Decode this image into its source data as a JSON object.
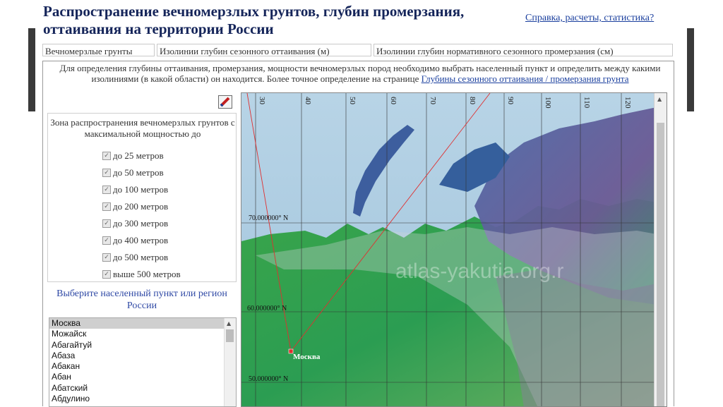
{
  "header": {
    "title_line1": "Распространение вечномерзлых грунтов, глубин промерзания,",
    "title_line2": "оттаивания на территории России",
    "help_link": "Справка, расчеты, статистика?"
  },
  "tabs": [
    {
      "label": "Вечномерзлые грунты"
    },
    {
      "label": "Изолинии глубин сезонного оттаивания (м)"
    },
    {
      "label": "Изолинии глубин нормативного сезонного промерзания (см)"
    }
  ],
  "instructions": {
    "text": "Для определения глубины оттаивания, промерзания, мощности вечномерзлых пород необходимо выбрать населенный пункт и определить между какими изолиниями (в какой области) он находится. Более точное определение на странице ",
    "link": "Глубины сезонного оттаивания / промерзания грунта"
  },
  "zone_panel": {
    "title": "Зона распространения вечномерзлых грунтов с максимальной мощностью до",
    "items": [
      {
        "label": "до 25  метров",
        "checked": true
      },
      {
        "label": "до 50  метров",
        "checked": true
      },
      {
        "label": "до 100 метров",
        "checked": true
      },
      {
        "label": "до 200 метров",
        "checked": true
      },
      {
        "label": "до 300 метров",
        "checked": true
      },
      {
        "label": "до 400 метров",
        "checked": true
      },
      {
        "label": "до 500 метров",
        "checked": true
      },
      {
        "label": "выше 500 метров",
        "checked": true
      }
    ]
  },
  "city_select": {
    "title": "Выберите населенный пункт или регион России",
    "selected": "Москва",
    "cities": [
      "Москва",
      "Можайск",
      "Абагайтуй",
      "Абаза",
      "Абакан",
      "Абан",
      "Абатский",
      "Абдулино"
    ]
  },
  "map": {
    "longitude_labels": [
      "30",
      "40",
      "50",
      "60",
      "70",
      "80",
      "90",
      "100",
      "110",
      "120"
    ],
    "latitude_labels": [
      "70.000000° N",
      "60.000000° N",
      "50.000000° N"
    ],
    "marker_label": "Москва",
    "watermark": "atlas-yakutia.org.r",
    "colors": {
      "sea": "#a9c8dd",
      "lowland": "#2fa64a",
      "highland": "#7a5a8a",
      "marker": "#e03030"
    }
  }
}
